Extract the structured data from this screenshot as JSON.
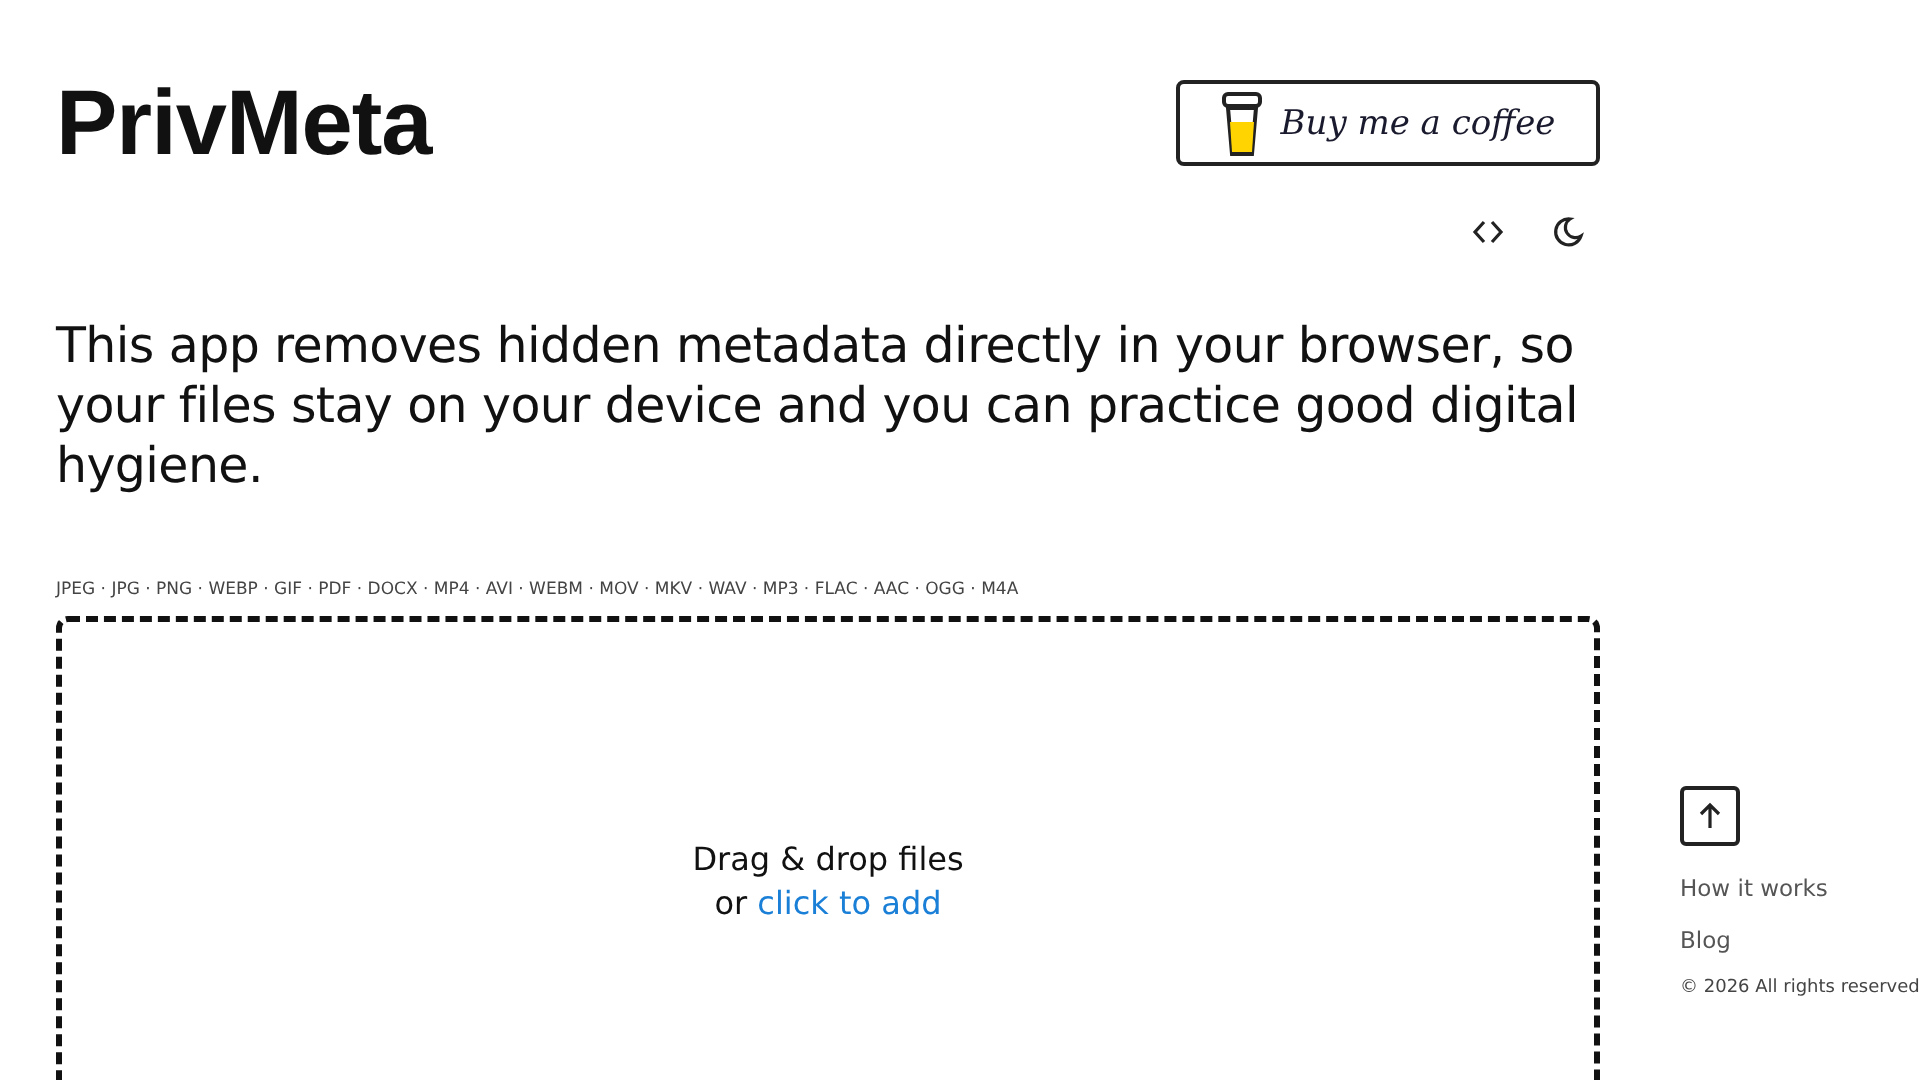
{
  "header": {
    "logo": "PrivMeta",
    "coffee_button": "Buy me a coffee"
  },
  "intro": "This app removes hidden metadata directly in your browser, so your files stay on your device and you can practice good digital hygiene.",
  "formats": "JPEG · JPG · PNG · WEBP · GIF · PDF · DOCX · MP4 · AVI · WEBM · MOV · MKV · WAV · MP3 · FLAC · AAC · OGG · M4A",
  "dropzone": {
    "prompt": "Drag & drop files",
    "prefix": "or",
    "link": "click to add"
  },
  "sidebar": {
    "links": [
      "How it works",
      "Blog"
    ],
    "copyright": "© 2026 All rights reserved"
  }
}
